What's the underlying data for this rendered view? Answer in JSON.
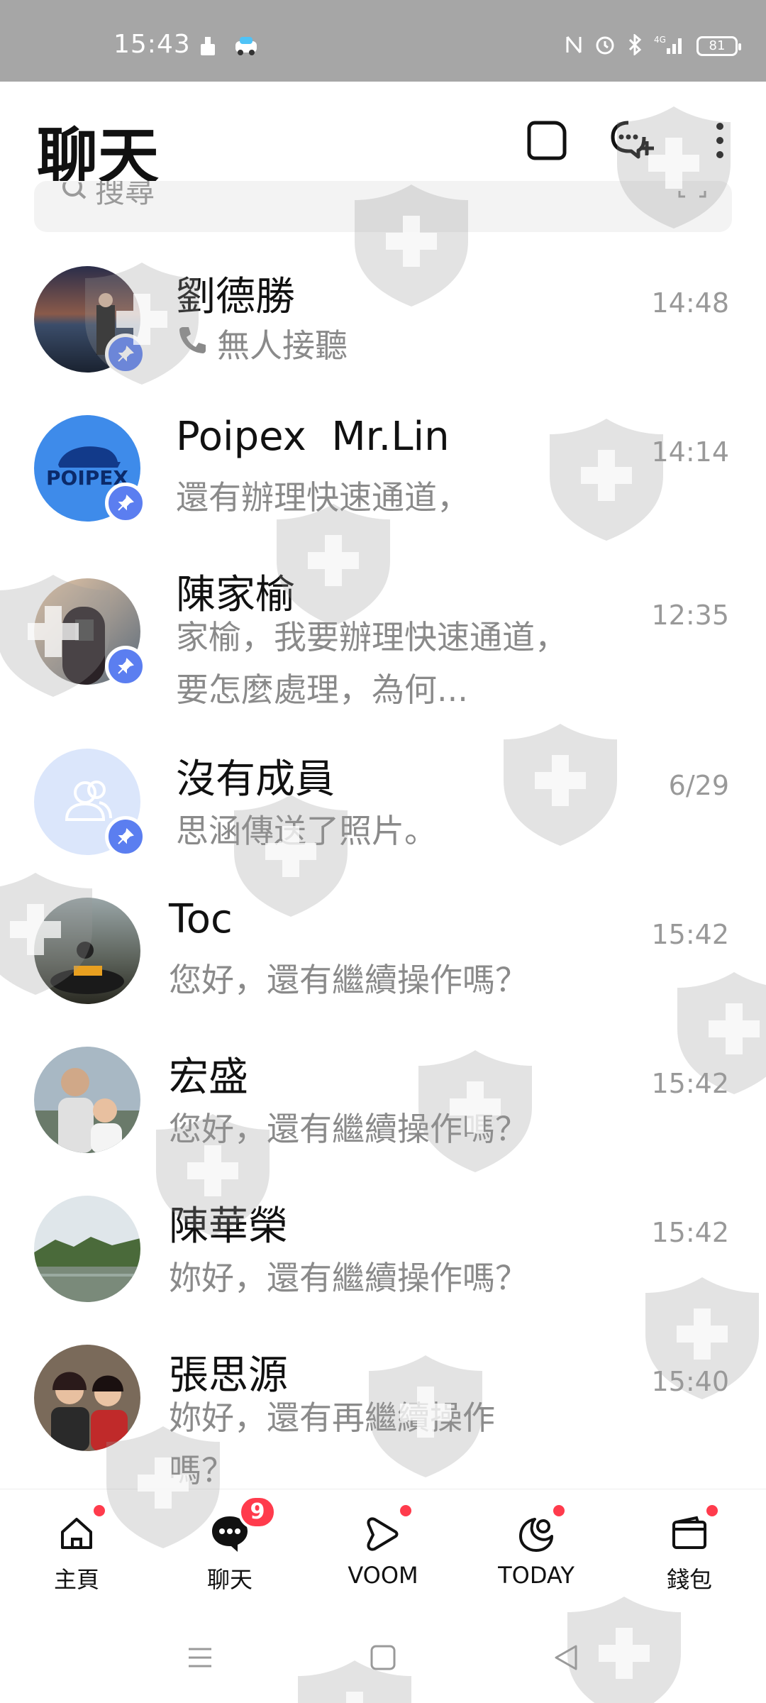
{
  "status_bar": {
    "time": "15:43",
    "battery": "81",
    "icons": [
      "cleaner-icon",
      "car-icon",
      "nfc-icon",
      "alarm-icon",
      "bluetooth-icon",
      "4g-signal-icon",
      "battery-icon"
    ]
  },
  "header": {
    "title": "聊天",
    "actions": [
      "note-icon",
      "new-chat-icon",
      "more-icon"
    ]
  },
  "search": {
    "placeholder": "搜尋"
  },
  "chats": [
    {
      "name": "劉德勝",
      "message": "無人接聽",
      "time": "14:48",
      "pinned": true,
      "call_icon": true
    },
    {
      "name": "Poipex  Mr.Lin",
      "message": "還有辦理快速通道，",
      "time": "14:14",
      "pinned": true,
      "avatar_text": "POIPEX"
    },
    {
      "name": "陳家榆",
      "message": "家榆，我要辦理快速通道，要怎麼處理，為何...",
      "time": "12:35",
      "pinned": true
    },
    {
      "name": "沒有成員",
      "message": "思涵傳送了照片。",
      "time": "6/29",
      "pinned": true
    },
    {
      "name": "Toc",
      "message": "您好，還有繼續操作嗎？",
      "time": "15:42",
      "pinned": false
    },
    {
      "name": "宏盛",
      "message": "您好，還有繼續操作嗎？",
      "time": "15:42",
      "pinned": false
    },
    {
      "name": "陳華榮",
      "message": "妳好，還有繼續操作嗎？",
      "time": "15:42",
      "pinned": false
    },
    {
      "name": "張思源",
      "message": "妳好，還有再繼續操作嗎？",
      "time": "15:40",
      "pinned": false
    }
  ],
  "bottom_nav": [
    {
      "label": "主頁",
      "icon": "home-icon",
      "dot": true
    },
    {
      "label": "聊天",
      "icon": "chat-bubble-icon",
      "badge": "9"
    },
    {
      "label": "VOOM",
      "icon": "voom-play-icon",
      "dot": true
    },
    {
      "label": "TODAY",
      "icon": "today-icon",
      "dot": true
    },
    {
      "label": "錢包",
      "icon": "wallet-icon",
      "dot": true
    }
  ],
  "colors": {
    "status_bar": "#a6a6a6",
    "pin_badge": "#5b7ef0",
    "badge_red": "#ff3b4c",
    "muted_text": "#8a8a8a"
  }
}
